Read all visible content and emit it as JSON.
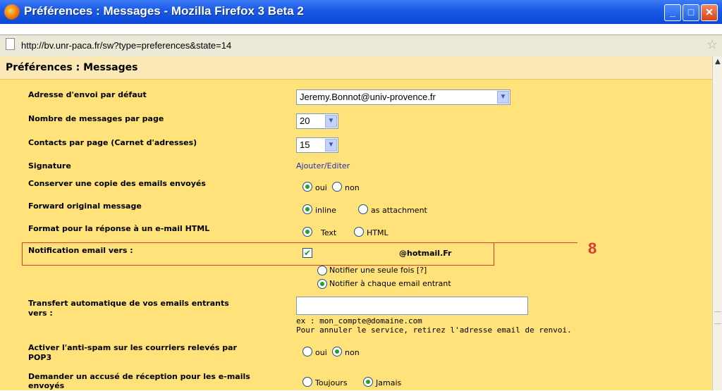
{
  "window": {
    "title": "Préférences : Messages - Mozilla Firefox 3 Beta 2",
    "url": "http://bv.unr-paca.fr/sw?type=preferences&state=14",
    "minimize": "_",
    "maximize": "□",
    "close": "✕"
  },
  "page": {
    "heading": "Préférences : Messages",
    "annotation": "8",
    "rows": {
      "sender": {
        "label": "Adresse d'envoi par défaut",
        "value": "Jeremy.Bonnot@univ-provence.fr"
      },
      "per_page": {
        "label": "Nombre de messages par page",
        "value": "20"
      },
      "contacts": {
        "label": "Contacts par page (Carnet d'adresses)",
        "value": "15"
      },
      "signature": {
        "label": "Signature",
        "link": "Ajouter/Editer"
      },
      "copy": {
        "label": "Conserver une copie des emails envoyés",
        "opt1": "oui",
        "opt2": "non"
      },
      "forward": {
        "label": "Forward original message",
        "opt1": "inline",
        "opt2": "as attachment"
      },
      "format": {
        "label": "Format pour la réponse à un e-mail HTML",
        "opt1": "Text",
        "opt2": "HTML"
      },
      "notify": {
        "label": "Notification email vers :",
        "email": "@hotmail.Fr",
        "opt1": "Notifier une seule fois [?]",
        "opt2": "Notifier à chaque email entrant"
      },
      "transfer": {
        "label_line1": "Transfert automatique de vos emails entrants",
        "label_line2": "vers :",
        "value": "",
        "hint1": "ex : mon_compte@domaine.com",
        "hint2": "Pour annuler le service, retirez l'adresse email de renvoi."
      },
      "antispam": {
        "label_line1": "Activer l'anti-spam sur les courriers relevés par",
        "label_line2": "POP3",
        "opt1": "oui",
        "opt2": "non"
      },
      "receipt": {
        "label_line1": "Demander un accusé de réception pour les e-mails",
        "label_line2": "envoyés",
        "opt1": "Toujours",
        "opt2": "Jamais"
      }
    }
  }
}
